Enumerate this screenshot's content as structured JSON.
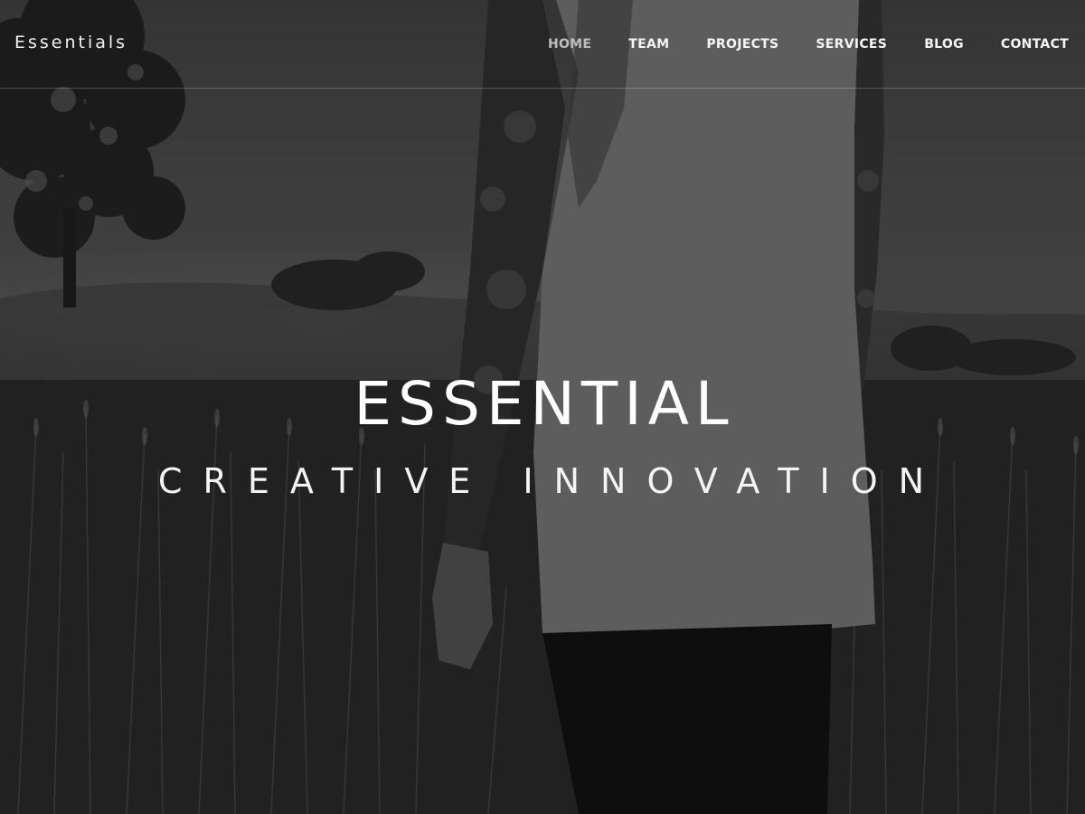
{
  "brand": {
    "name": "Essentials"
  },
  "nav": {
    "items": [
      {
        "label": "HOME",
        "active": true
      },
      {
        "label": "TEAM",
        "active": false
      },
      {
        "label": "PROJECTS",
        "active": false
      },
      {
        "label": "SERVICES",
        "active": false
      },
      {
        "label": "BLOG",
        "active": false
      },
      {
        "label": "CONTACT",
        "active": false
      }
    ]
  },
  "hero": {
    "title": "ESSENTIAL",
    "subtitle": "CREATIVE INNOVATION",
    "background_icon": "grayscale-photo-person-in-field"
  },
  "colors": {
    "text": "#ffffff",
    "active_nav": "#bdbdbd",
    "divider": "rgba(255,255,255,0.22)"
  }
}
